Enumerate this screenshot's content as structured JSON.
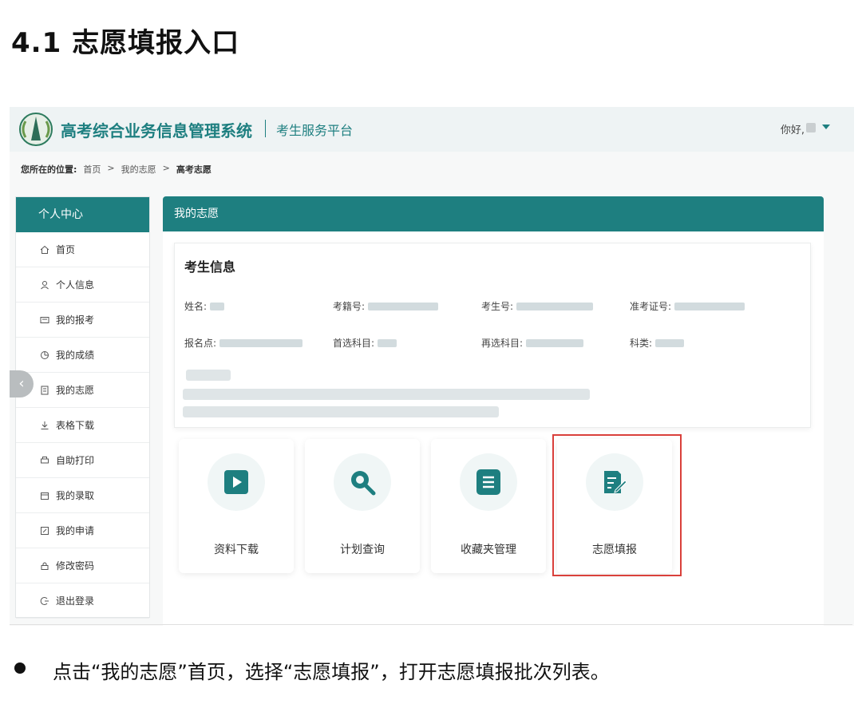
{
  "doc": {
    "heading": "4.1 志愿填报入口",
    "bullet_text": "点击“我的志愿”首页，选择“志愿填报”，打开志愿填报批次列表。"
  },
  "header": {
    "system_title": "高考综合业务信息管理系统",
    "platform": "考生服务平台",
    "greeting": "你好,"
  },
  "breadcrumb": {
    "prefix": "您所在的位置:",
    "items": [
      "首页",
      ">",
      "我的志愿",
      ">",
      "高考志愿"
    ]
  },
  "sidebar": {
    "title": "个人中心",
    "items": [
      {
        "label": "首页",
        "icon": "home-icon"
      },
      {
        "label": "个人信息",
        "icon": "user-icon"
      },
      {
        "label": "我的报考",
        "icon": "id-card-icon"
      },
      {
        "label": "我的成绩",
        "icon": "pie-chart-icon"
      },
      {
        "label": "我的志愿",
        "icon": "form-icon"
      },
      {
        "label": "表格下载",
        "icon": "download-icon"
      },
      {
        "label": "自助打印",
        "icon": "printer-icon"
      },
      {
        "label": "我的录取",
        "icon": "calendar-icon"
      },
      {
        "label": "我的申请",
        "icon": "edit-icon"
      },
      {
        "label": "修改密码",
        "icon": "lock-icon"
      },
      {
        "label": "退出登录",
        "icon": "logout-icon"
      }
    ]
  },
  "main": {
    "panel_title": "我的志愿",
    "info": {
      "title": "考生信息",
      "fields": {
        "name": "姓名:",
        "exam_reg": "考籍号:",
        "candidate_no": "考生号:",
        "admission_no": "准考证号:",
        "site": "报名点:",
        "first_subject": "首选科目:",
        "second_subject": "再选科目:",
        "category": "科类:"
      }
    },
    "tiles": [
      {
        "label": "资料下载",
        "icon": "play-icon"
      },
      {
        "label": "计划查询",
        "icon": "search-icon"
      },
      {
        "label": "收藏夹管理",
        "icon": "list-icon"
      },
      {
        "label": "志愿填报",
        "icon": "edit-form-icon"
      }
    ]
  },
  "colors": {
    "accent": "#1e7f80",
    "highlight": "#d9403b"
  }
}
